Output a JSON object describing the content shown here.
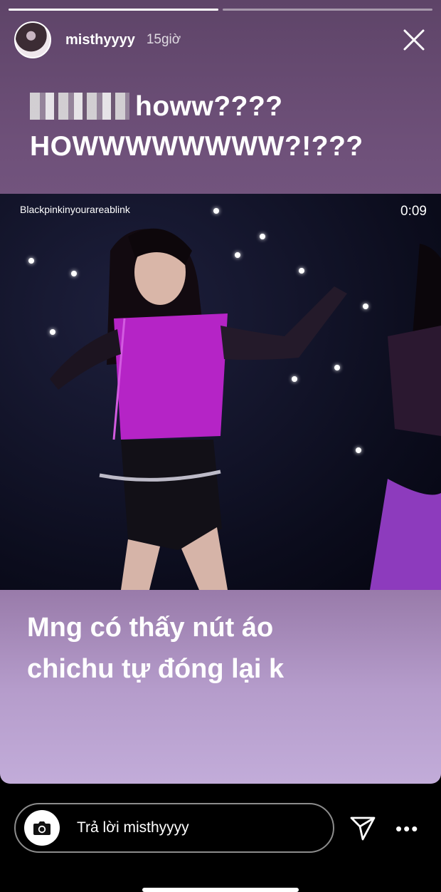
{
  "story": {
    "progress": [
      1,
      0
    ],
    "username": "misthyyyy",
    "time": "15giờ",
    "caption_top": "howw???? HOWWWWWWWW?!???",
    "video": {
      "watermark": "Blackpinkinyourareablink",
      "duration": "0:09"
    },
    "caption_bottom_line1": "Mng có thấy nút áo",
    "caption_bottom_line2": "chichu tự đóng lại k"
  },
  "reply": {
    "placeholder": "Trả lời misthyyyy"
  },
  "icons": {
    "close": "close-icon",
    "camera": "camera-icon",
    "send": "send-icon",
    "more": "more-icon"
  }
}
